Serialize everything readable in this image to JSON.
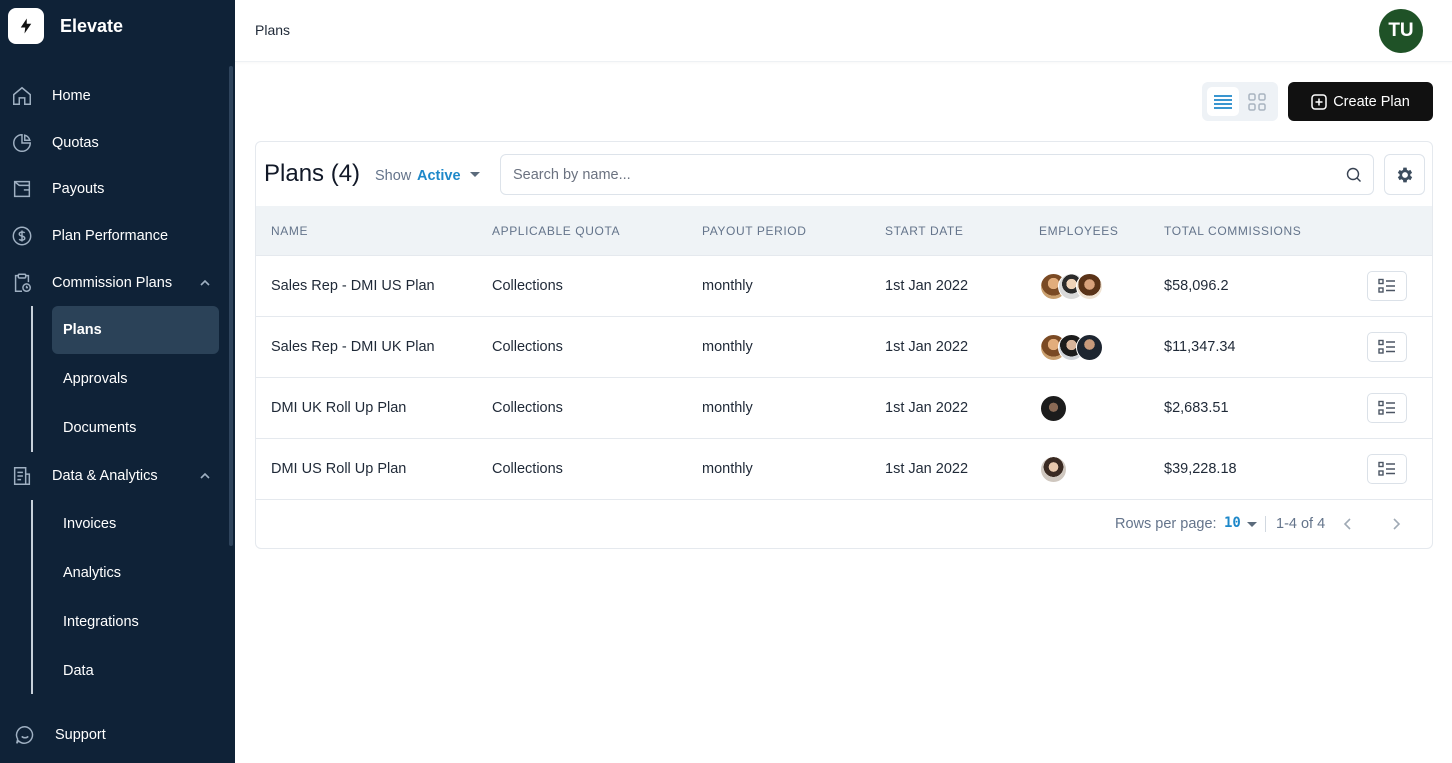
{
  "app": {
    "name": "Elevate"
  },
  "sidebar": {
    "items": [
      {
        "label": "Home",
        "icon": "home-icon"
      },
      {
        "label": "Quotas",
        "icon": "pie-chart-icon"
      },
      {
        "label": "Payouts",
        "icon": "wallet-icon"
      },
      {
        "label": "Plan Performance",
        "icon": "dollar-circle-icon"
      },
      {
        "label": "Commission Plans",
        "icon": "clipboard-icon"
      },
      {
        "label": "Data & Analytics",
        "icon": "report-icon"
      },
      {
        "label": "Support",
        "icon": "chat-bubble-icon"
      }
    ],
    "commission_sub": [
      {
        "label": "Plans"
      },
      {
        "label": "Approvals"
      },
      {
        "label": "Documents"
      }
    ],
    "analytics_sub": [
      {
        "label": "Invoices"
      },
      {
        "label": "Analytics"
      },
      {
        "label": "Integrations"
      },
      {
        "label": "Data"
      }
    ]
  },
  "header": {
    "breadcrumb": "Plans",
    "user_initials": "TU"
  },
  "toolbar": {
    "create_label": "Create Plan"
  },
  "plans": {
    "title": "Plans (4)",
    "show_label": "Show",
    "show_value": "Active",
    "search_placeholder": "Search by name...",
    "columns": [
      "NAME",
      "APPLICABLE QUOTA",
      "PAYOUT PERIOD",
      "START DATE",
      "EMPLOYEES",
      "TOTAL COMMISSIONS"
    ],
    "rows": [
      {
        "name": "Sales Rep - DMI US Plan",
        "quota": "Collections",
        "period": "monthly",
        "start": "1st Jan 2022",
        "employees": 3,
        "total": "$58,096.2"
      },
      {
        "name": "Sales Rep - DMI UK Plan",
        "quota": "Collections",
        "period": "monthly",
        "start": "1st Jan 2022",
        "employees": 3,
        "total": "$11,347.34"
      },
      {
        "name": "DMI UK Roll Up Plan",
        "quota": "Collections",
        "period": "monthly",
        "start": "1st Jan 2022",
        "employees": 1,
        "total": "$2,683.51"
      },
      {
        "name": "DMI US Roll Up Plan",
        "quota": "Collections",
        "period": "monthly",
        "start": "1st Jan 2022",
        "employees": 1,
        "total": "$39,228.18"
      }
    ]
  },
  "pagination": {
    "rows_per_page_label": "Rows per page:",
    "rows_per_page": "10",
    "range": "1-4 of 4"
  },
  "colors": {
    "sidebar_bg": "#0f2237",
    "accent": "#1e88c9",
    "avatar_bg": "#1f5227",
    "primary_button": "#111111"
  }
}
